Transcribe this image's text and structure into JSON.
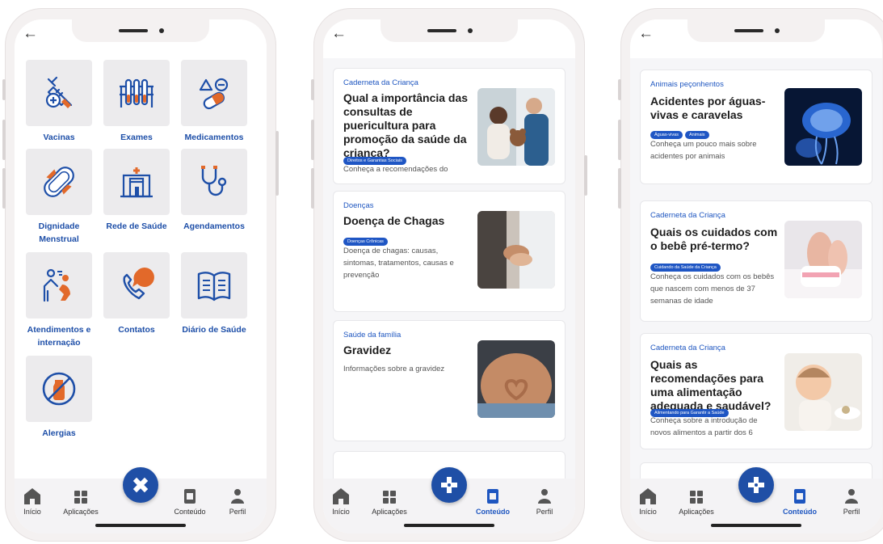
{
  "colors": {
    "accent": "#1e4fa8",
    "fab": "#1f4fa6",
    "tile_bg": "#ecebed",
    "icon_orange": "#e2692a"
  },
  "phone1": {
    "tiles": [
      {
        "label": "Vacinas",
        "icon": "vaccine-icon"
      },
      {
        "label": "Exames",
        "icon": "test-tubes-icon"
      },
      {
        "label": "Medicamentos",
        "icon": "pills-icon"
      },
      {
        "label": "Dignidade Menstrual",
        "icon": "pad-icon"
      },
      {
        "label": "Rede de Saúde",
        "icon": "hospital-icon"
      },
      {
        "label": "Agendamentos",
        "icon": "stethoscope-icon"
      },
      {
        "label": "Atendimentos e internação",
        "icon": "care-icon"
      },
      {
        "label": "Contatos",
        "icon": "phone-icon"
      },
      {
        "label": "Diário de Saúde",
        "icon": "book-icon"
      },
      {
        "label": "Alergias",
        "icon": "allergy-icon"
      }
    ],
    "tabs": [
      "Início",
      "Aplicações",
      "Conteúdo",
      "Perfil"
    ]
  },
  "phone2": {
    "cards": [
      {
        "category": "Caderneta da Criança",
        "title": "Qual a importância das consultas de puericultura para promoção da saúde da criança?",
        "tags": [
          "Direitos e Garantias Sociais"
        ],
        "desc": "Conheça a recomendações do"
      },
      {
        "category": "Doenças",
        "title": "Doença de Chagas",
        "tags": [
          "Doenças Crônicas"
        ],
        "desc": "Doença de chagas: causas, sintomas, tratamentos, causas e prevenção"
      },
      {
        "category": "Saúde da família",
        "title": "Gravidez",
        "tags": [],
        "desc": "Informações sobre a gravidez"
      }
    ],
    "tabs": [
      "Início",
      "Aplicações",
      "Conteúdo",
      "Perfil"
    ]
  },
  "phone3": {
    "cards": [
      {
        "category": "Animais peçonhentos",
        "title": "Acidentes por águas-vivas e caravelas",
        "tags": [
          "Águas-vivas",
          "Animais"
        ],
        "desc": "Conheça um pouco mais sobre acidentes por animais"
      },
      {
        "category": "Caderneta da Criança",
        "title": "Quais os cuidados com o bebê pré-termo?",
        "tags": [
          "Cuidando da Saúde da Criança"
        ],
        "desc": "Conheça os cuidados com os bebês que nascem com menos de 37 semanas de idade"
      },
      {
        "category": "Caderneta da Criança",
        "title": "Quais as recomendações para uma alimentação adequada e saudável?",
        "tags": [
          "Alimentando para Garantir a Saúde"
        ],
        "desc": "Conheça sobre a introdução de novos alimentos a partir dos 6"
      }
    ],
    "tabs": [
      "Início",
      "Aplicações",
      "Conteúdo",
      "Perfil"
    ]
  }
}
